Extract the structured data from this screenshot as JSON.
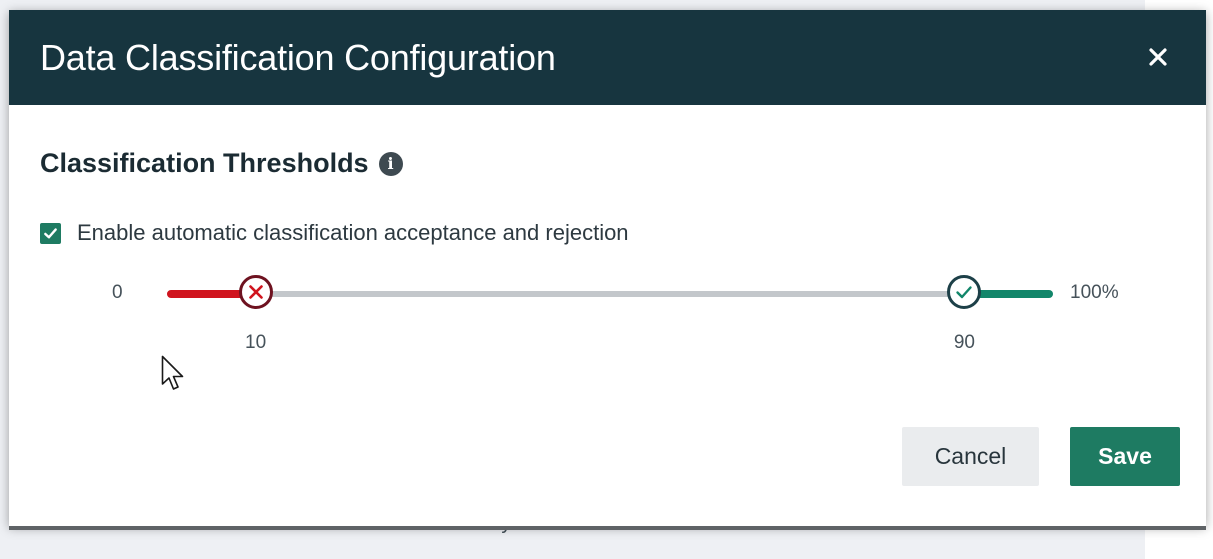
{
  "background": {
    "partial_text": "System User"
  },
  "dialog": {
    "title": "Data Classification Configuration",
    "close_icon": "close-icon"
  },
  "thresholds": {
    "section_title": "Classification Thresholds",
    "info_icon": "info-icon",
    "enable_checkbox": {
      "label": "Enable automatic classification acceptance and rejection",
      "checked": true
    },
    "slider": {
      "min_label": "0",
      "max_label": "100%",
      "reject_value": 10,
      "accept_value": 90,
      "reject_label": "10",
      "accept_label": "90",
      "reject_icon": "x-circle-icon",
      "accept_icon": "check-circle-icon"
    }
  },
  "actions": {
    "cancel_label": "Cancel",
    "save_label": "Save"
  },
  "colors": {
    "header_bg": "#17353f",
    "accent_green": "#1e7b62",
    "reject_red": "#d0141e",
    "accept_green": "#12866a"
  }
}
